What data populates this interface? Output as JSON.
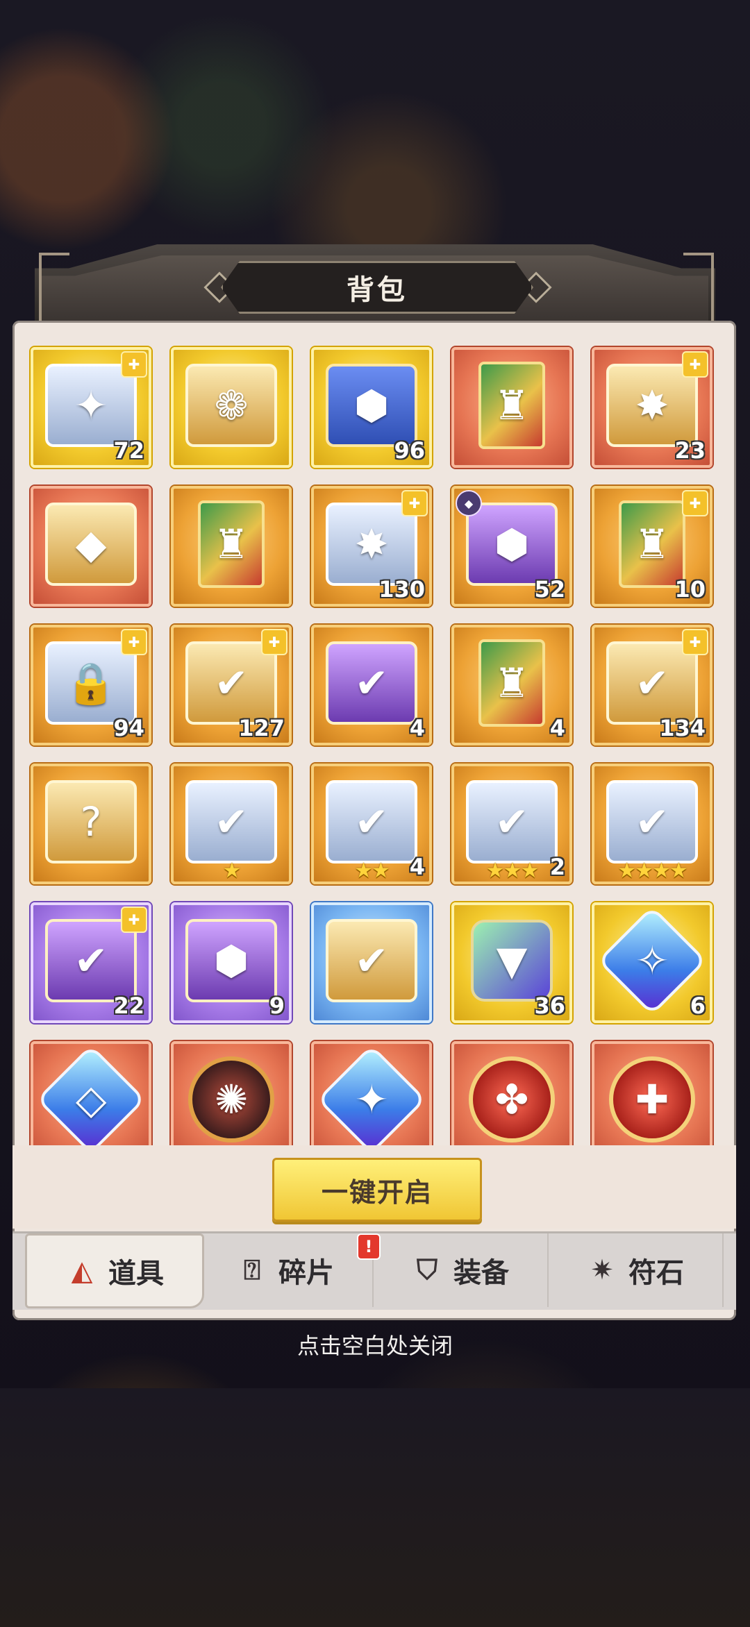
{
  "panel": {
    "title": "背包"
  },
  "items": [
    {
      "icon": "silver-chest-icon",
      "art": "art-chest-silver",
      "glyph": "✦",
      "color": "yellow",
      "count": "72",
      "puzzle": true
    },
    {
      "icon": "flower-chest-icon",
      "art": "art-chest",
      "glyph": "❁",
      "color": "yellow",
      "count": "",
      "puzzle": false
    },
    {
      "icon": "winged-blue-chest-icon",
      "art": "art-chest-blue",
      "glyph": "⬢",
      "color": "yellow",
      "count": "96",
      "puzzle": false
    },
    {
      "icon": "hero-card-icon",
      "art": "art-card",
      "glyph": "♜",
      "color": "red",
      "count": "",
      "puzzle": false
    },
    {
      "icon": "red-gem-chest-icon",
      "art": "art-chest",
      "glyph": "✸",
      "color": "red",
      "count": "23",
      "puzzle": true
    },
    {
      "icon": "diamond-chest-icon",
      "art": "art-chest",
      "glyph": "◆",
      "color": "red",
      "count": "",
      "puzzle": false
    },
    {
      "icon": "hero-card-icon",
      "art": "art-card",
      "glyph": "♜",
      "color": "orange",
      "count": "",
      "puzzle": false
    },
    {
      "icon": "silver-star-chest-icon",
      "art": "art-chest-silver",
      "glyph": "✸",
      "color": "orange",
      "count": "130",
      "puzzle": true
    },
    {
      "icon": "winged-gold-chest-icon",
      "art": "art-chest-purple",
      "glyph": "⬢",
      "color": "orange",
      "count": "52",
      "puzzle": false,
      "rank": true
    },
    {
      "icon": "hero-card-icon",
      "art": "art-card",
      "glyph": "♜",
      "color": "orange",
      "count": "10",
      "puzzle": true
    },
    {
      "icon": "locked-chest-icon",
      "art": "art-chest-silver",
      "glyph": "🔒",
      "color": "orange",
      "count": "94",
      "puzzle": true
    },
    {
      "icon": "gold-check-chest-icon",
      "art": "art-chest",
      "glyph": "✔",
      "color": "orange",
      "count": "127",
      "puzzle": true
    },
    {
      "icon": "egg-chest-icon",
      "art": "art-chest-purple",
      "glyph": "✔",
      "color": "orange",
      "count": "4",
      "puzzle": false
    },
    {
      "icon": "hero-card-icon",
      "art": "art-card",
      "glyph": "♜",
      "color": "orange",
      "count": "4",
      "puzzle": false
    },
    {
      "icon": "card-select-chest-icon",
      "art": "art-chest",
      "glyph": "✔",
      "color": "orange",
      "count": "134",
      "puzzle": true
    },
    {
      "icon": "mystery-chest-icon",
      "art": "art-chest",
      "glyph": "?",
      "color": "orange",
      "count": "",
      "puzzle": false
    },
    {
      "icon": "equipment-chest-icon",
      "art": "art-chest-silver",
      "glyph": "✔",
      "color": "orange",
      "count": "",
      "puzzle": false,
      "stars": "★"
    },
    {
      "icon": "equipment-chest-icon",
      "art": "art-chest-silver",
      "glyph": "✔",
      "color": "orange",
      "count": "4",
      "puzzle": false,
      "stars": "★★"
    },
    {
      "icon": "equipment-chest-icon",
      "art": "art-chest-silver",
      "glyph": "✔",
      "color": "orange",
      "count": "2",
      "puzzle": false,
      "stars": "★★★"
    },
    {
      "icon": "equipment-chest-icon",
      "art": "art-chest-silver",
      "glyph": "✔",
      "color": "orange",
      "count": "",
      "puzzle": false,
      "stars": "★★★★"
    },
    {
      "icon": "purple-check-chest-icon",
      "art": "art-chest-purple",
      "glyph": "✔",
      "color": "purple",
      "count": "22",
      "puzzle": true
    },
    {
      "icon": "purple-gold-chest-icon",
      "art": "art-chest-purple",
      "glyph": "⬢",
      "color": "purple",
      "count": "9",
      "puzzle": false
    },
    {
      "icon": "gear-select-chest-icon",
      "art": "art-chest",
      "glyph": "✔",
      "color": "blue",
      "count": "",
      "puzzle": false
    },
    {
      "icon": "triangle-gem-icon",
      "art": "art-tri",
      "glyph": "▼",
      "color": "yellow",
      "count": "36",
      "puzzle": false
    },
    {
      "icon": "blue-crystal-icon",
      "art": "art-gem",
      "glyph": "✧",
      "color": "yellow",
      "count": "6",
      "puzzle": false
    },
    {
      "icon": "crystal-cube-icon",
      "art": "art-gem",
      "glyph": "◇",
      "color": "red",
      "count": "",
      "puzzle": false
    },
    {
      "icon": "crimson-orb-icon",
      "art": "art-orb",
      "glyph": "✺",
      "color": "red",
      "count": "",
      "puzzle": false
    },
    {
      "icon": "prism-crystal-icon",
      "art": "art-gem",
      "glyph": "✦",
      "color": "red",
      "count": "",
      "puzzle": false
    },
    {
      "icon": "gold-crest-icon",
      "art": "art-badge",
      "glyph": "✤",
      "color": "red",
      "count": "",
      "puzzle": false
    },
    {
      "icon": "red-medal-icon",
      "art": "art-badge",
      "glyph": "✚",
      "color": "red",
      "count": "",
      "puzzle": false
    }
  ],
  "actions": {
    "open_all": "一键开启"
  },
  "tabs": [
    {
      "label": "道具",
      "icon": "potion-icon",
      "glyph": "◭",
      "active": true,
      "alert": false
    },
    {
      "label": "碎片",
      "icon": "mystery-box-icon",
      "glyph": "⍰",
      "active": false,
      "alert": true
    },
    {
      "label": "装备",
      "icon": "shield-icon",
      "glyph": "⛉",
      "active": false,
      "alert": false
    },
    {
      "label": "符石",
      "icon": "rune-star-icon",
      "glyph": "✷",
      "active": false,
      "alert": false
    }
  ],
  "alert_badge": "!",
  "footer": {
    "close_hint": "点击空白处关闭"
  }
}
